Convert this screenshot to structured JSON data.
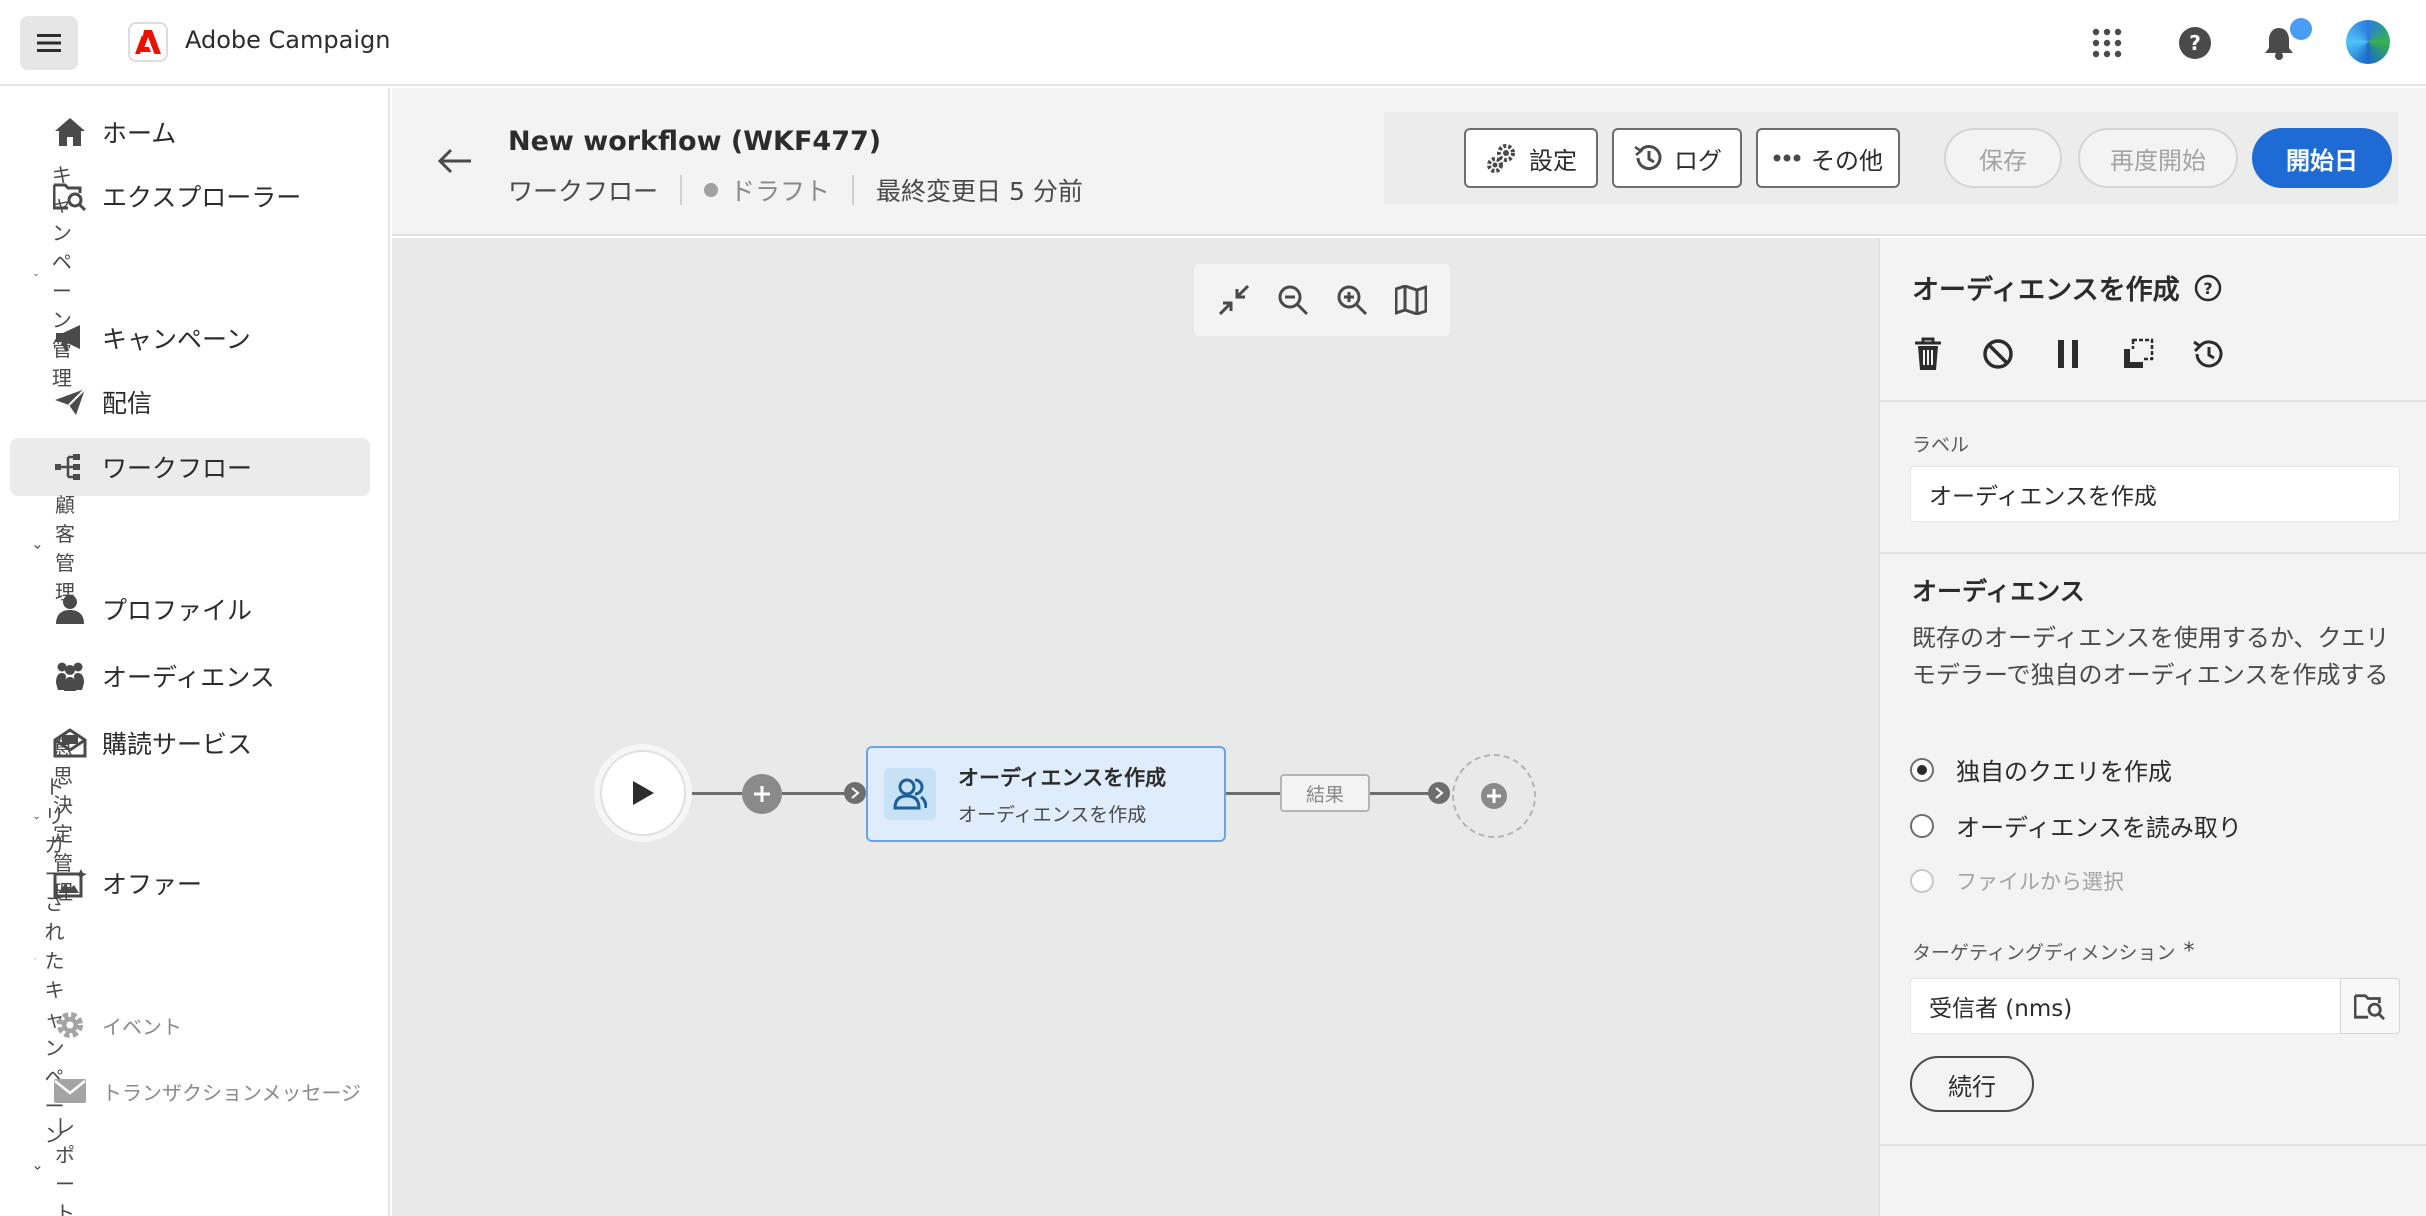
{
  "app": {
    "name": "Adobe Campaign"
  },
  "sidebar": {
    "items": [
      {
        "label": "ホーム",
        "icon": "home-icon"
      },
      {
        "label": "エクスプローラー",
        "icon": "explorer-icon"
      },
      {
        "section": "キャンペーン管理"
      },
      {
        "label": "キャンペーン",
        "icon": "megaphone-icon"
      },
      {
        "label": "配信",
        "icon": "send-icon"
      },
      {
        "label": "ワークフロー",
        "icon": "workflow-icon",
        "active": true
      },
      {
        "section": "顧客管理"
      },
      {
        "label": "プロファイル",
        "icon": "user-icon"
      },
      {
        "label": "オーディエンス",
        "icon": "users-icon"
      },
      {
        "label": "購読サービス",
        "icon": "subscription-icon"
      },
      {
        "section": "意思決定管理"
      },
      {
        "label": "オファー",
        "icon": "offer-icon"
      },
      {
        "section": "トリガーされたキャンペーン"
      },
      {
        "label": "イベント",
        "icon": "gear-icon",
        "disabled": true
      },
      {
        "label": "トランザクションメッセージ",
        "icon": "mail-icon",
        "disabled": true
      },
      {
        "section": "レポート"
      }
    ]
  },
  "header": {
    "title": "New workflow (WKF477)",
    "type": "ワークフロー",
    "status": "ドラフト",
    "modified": "最終変更日 5 分前",
    "buttons": {
      "settings": "設定",
      "log": "ログ",
      "more": "その他",
      "save": "保存",
      "restart": "再度開始",
      "start": "開始日"
    }
  },
  "canvas": {
    "activity": {
      "title": "オーディエンスを作成",
      "subtitle": "オーディエンスを作成"
    },
    "result_label": "結果"
  },
  "panel": {
    "title": "オーディエンスを作成",
    "label_field": {
      "label": "ラベル",
      "value": "オーディエンスを作成"
    },
    "audience_section": "オーディエンス",
    "description": "既存のオーディエンスを使用するか、クエリモデラーで独自のオーディエンスを作成する",
    "options": [
      {
        "label": "独自のクエリを作成",
        "selected": true
      },
      {
        "label": "オーディエンスを読み取り",
        "selected": false
      },
      {
        "label": "ファイルから選択",
        "selected": false,
        "disabled": true
      }
    ],
    "targeting": {
      "label": "ターゲティングディメンション",
      "required": "*",
      "value": "受信者 (nms)"
    },
    "continue": "続行"
  },
  "colors": {
    "primary": "#1f6bd6",
    "activity_bg": "#dfecfb",
    "activity_border": "#6aa3e8",
    "notification": "#4b9cf5"
  }
}
